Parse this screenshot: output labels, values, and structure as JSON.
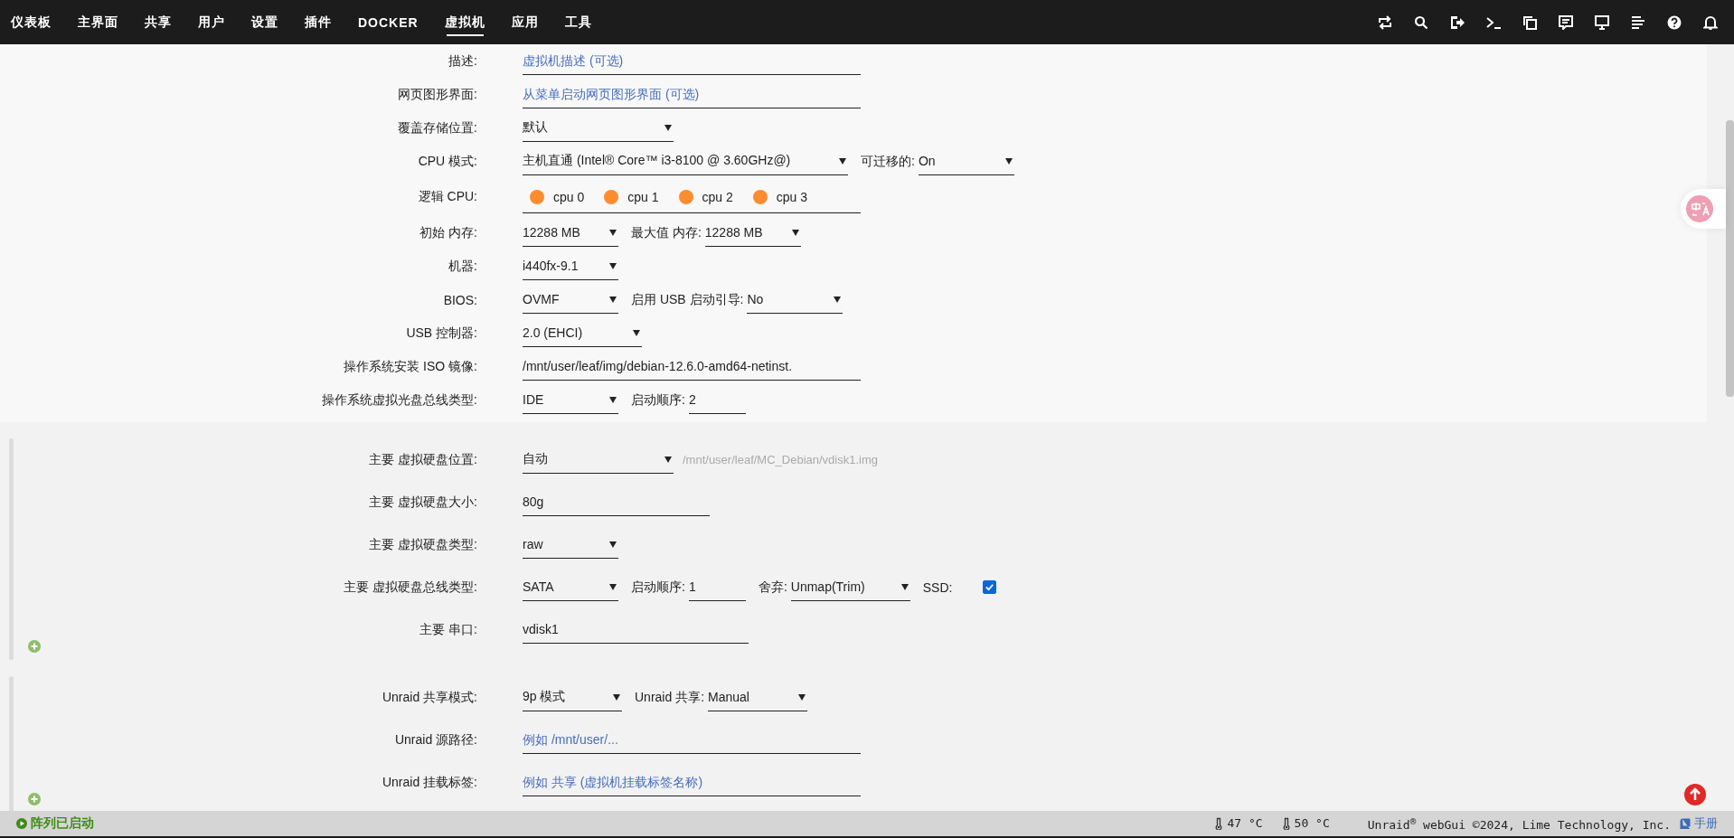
{
  "nav": {
    "items": [
      {
        "label": "仪表板",
        "selected": false
      },
      {
        "label": "主界面",
        "selected": false
      },
      {
        "label": "共享",
        "selected": false
      },
      {
        "label": "用户",
        "selected": false
      },
      {
        "label": "设置",
        "selected": false
      },
      {
        "label": "插件",
        "selected": false
      },
      {
        "label": "DOCKER",
        "selected": false
      },
      {
        "label": "虚拟机",
        "selected": true
      },
      {
        "label": "应用",
        "selected": false
      },
      {
        "label": "工具",
        "selected": false
      }
    ]
  },
  "sections": [
    {
      "rows": [
        {
          "label": "描述:",
          "items": [
            {
              "kind": "field",
              "placeholder": "虚拟机描述 (可选)"
            }
          ]
        },
        {
          "label": "网页图形界面:",
          "items": [
            {
              "kind": "field",
              "placeholder": "从菜单启动网页图形界面 (可选)"
            }
          ]
        },
        {
          "label": "覆盖存储位置:",
          "items": [
            {
              "kind": "select",
              "value": "默认"
            }
          ]
        },
        {
          "label": "CPU 模式:",
          "items": [
            {
              "kind": "select",
              "value": "主机直通 (Intel® Core™ i3-8100 @ 3.60GHz@)"
            },
            {
              "kind": "label",
              "text": "可迁移的:"
            },
            {
              "kind": "select",
              "value": "On"
            }
          ]
        },
        {
          "label": "逻辑 CPU:",
          "items": [
            {
              "kind": "cpus",
              "cpus": [
                {
                  "label": "cpu 0",
                  "checked": true
                },
                {
                  "label": "cpu 1",
                  "checked": true
                },
                {
                  "label": "cpu 2",
                  "checked": true
                },
                {
                  "label": "cpu 3",
                  "checked": true
                }
              ]
            }
          ]
        },
        {
          "label": "初始 内存:",
          "items": [
            {
              "kind": "select",
              "value": "12288 MB"
            },
            {
              "kind": "label",
              "text": "最大值 内存:"
            },
            {
              "kind": "select",
              "value": "12288 MB"
            }
          ]
        },
        {
          "label": "机器:",
          "items": [
            {
              "kind": "select",
              "value": "i440fx-9.1"
            }
          ]
        },
        {
          "label": "BIOS:",
          "items": [
            {
              "kind": "select",
              "value": "OVMF"
            },
            {
              "kind": "label",
              "text": "启用 USB 启动引导:"
            },
            {
              "kind": "select",
              "value": "No"
            }
          ]
        },
        {
          "label": "USB 控制器:",
          "items": [
            {
              "kind": "select",
              "value": "2.0 (EHCI)"
            }
          ]
        },
        {
          "label": "操作系统安装 ISO 镜像:",
          "items": [
            {
              "kind": "field",
              "value": "/mnt/user/leaf/img/debian-12.6.0-amd64-netinst."
            }
          ]
        },
        {
          "label": "操作系统虚拟光盘总线类型:",
          "items": [
            {
              "kind": "select",
              "value": "IDE"
            },
            {
              "kind": "label",
              "text": "启动顺序:"
            },
            {
              "kind": "field",
              "value": "2"
            }
          ]
        }
      ]
    },
    {
      "rows": [
        {
          "label": "主要 虚拟硬盘位置:",
          "items": [
            {
              "kind": "select",
              "value": "自动"
            },
            {
              "kind": "hint",
              "text": "/mnt/user/leaf/MC_Debian/vdisk1.img"
            }
          ]
        },
        {
          "label": "主要 虚拟硬盘大小:",
          "items": [
            {
              "kind": "field",
              "value": "80g"
            }
          ]
        },
        {
          "label": "主要 虚拟硬盘类型:",
          "items": [
            {
              "kind": "select",
              "value": "raw"
            }
          ]
        },
        {
          "label": "主要 虚拟硬盘总线类型:",
          "items": [
            {
              "kind": "select",
              "value": "SATA"
            },
            {
              "kind": "label",
              "text": "启动顺序:"
            },
            {
              "kind": "field",
              "value": "1"
            },
            {
              "kind": "label",
              "text": "舍弃:"
            },
            {
              "kind": "select",
              "value": "Unmap(Trim)"
            },
            {
              "kind": "label",
              "text": "SSD:"
            },
            {
              "kind": "checkbox",
              "checked": true
            }
          ]
        },
        {
          "label": "主要 串口:",
          "items": [
            {
              "kind": "field",
              "value": "vdisk1"
            }
          ]
        }
      ]
    },
    {
      "rows": [
        {
          "label": "Unraid 共享模式:",
          "items": [
            {
              "kind": "select",
              "value": "9p 模式"
            },
            {
              "kind": "label",
              "text": "Unraid 共享:"
            },
            {
              "kind": "select",
              "value": "Manual"
            }
          ]
        },
        {
          "label": "Unraid 源路径:",
          "items": [
            {
              "kind": "field",
              "placeholder": "例如 /mnt/user/..."
            }
          ]
        },
        {
          "label": "Unraid 挂载标签:",
          "items": [
            {
              "kind": "field",
              "placeholder": "例如 共享 (虚拟机挂载标签名称)"
            }
          ]
        }
      ]
    }
  ],
  "status_bar": {
    "array_status": "阵列已启动",
    "temps": [
      "47 °C",
      "50 °C"
    ],
    "copyright": "Unraid$^{®}$ webGui ©2024, Lime Technology, Inc.",
    "manual": "手册"
  }
}
